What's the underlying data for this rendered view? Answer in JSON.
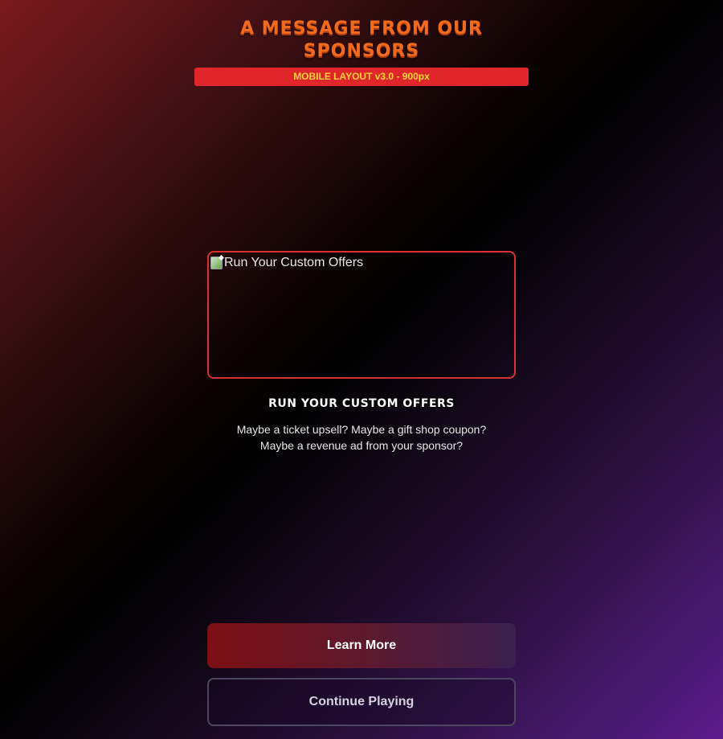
{
  "header": {
    "title": "A MESSAGE FROM OUR SPONSORS",
    "version_label": "MOBILE LAYOUT v3.0 - 900px"
  },
  "ad": {
    "image_alt": "Run Your Custom Offers",
    "heading": "RUN YOUR CUSTOM OFFERS",
    "description_line1": "Maybe a ticket upsell? Maybe a gift shop coupon?",
    "description_line2": "Maybe a revenue ad from your sponsor?"
  },
  "actions": {
    "primary_label": "Learn More",
    "secondary_label": "Continue Playing"
  },
  "colors": {
    "title_orange": "#f26b1d",
    "version_bar_red": "#e0262b",
    "version_text_yellow": "#ffd23a",
    "ad_border_red": "#d63030",
    "primary_button_start": "#7d0f14",
    "primary_button_end": "#3a2050",
    "background_top_left": "#7a1a1f",
    "background_bottom_right": "#5b1a8c"
  },
  "icons": {
    "broken_image": "broken-image-icon"
  }
}
